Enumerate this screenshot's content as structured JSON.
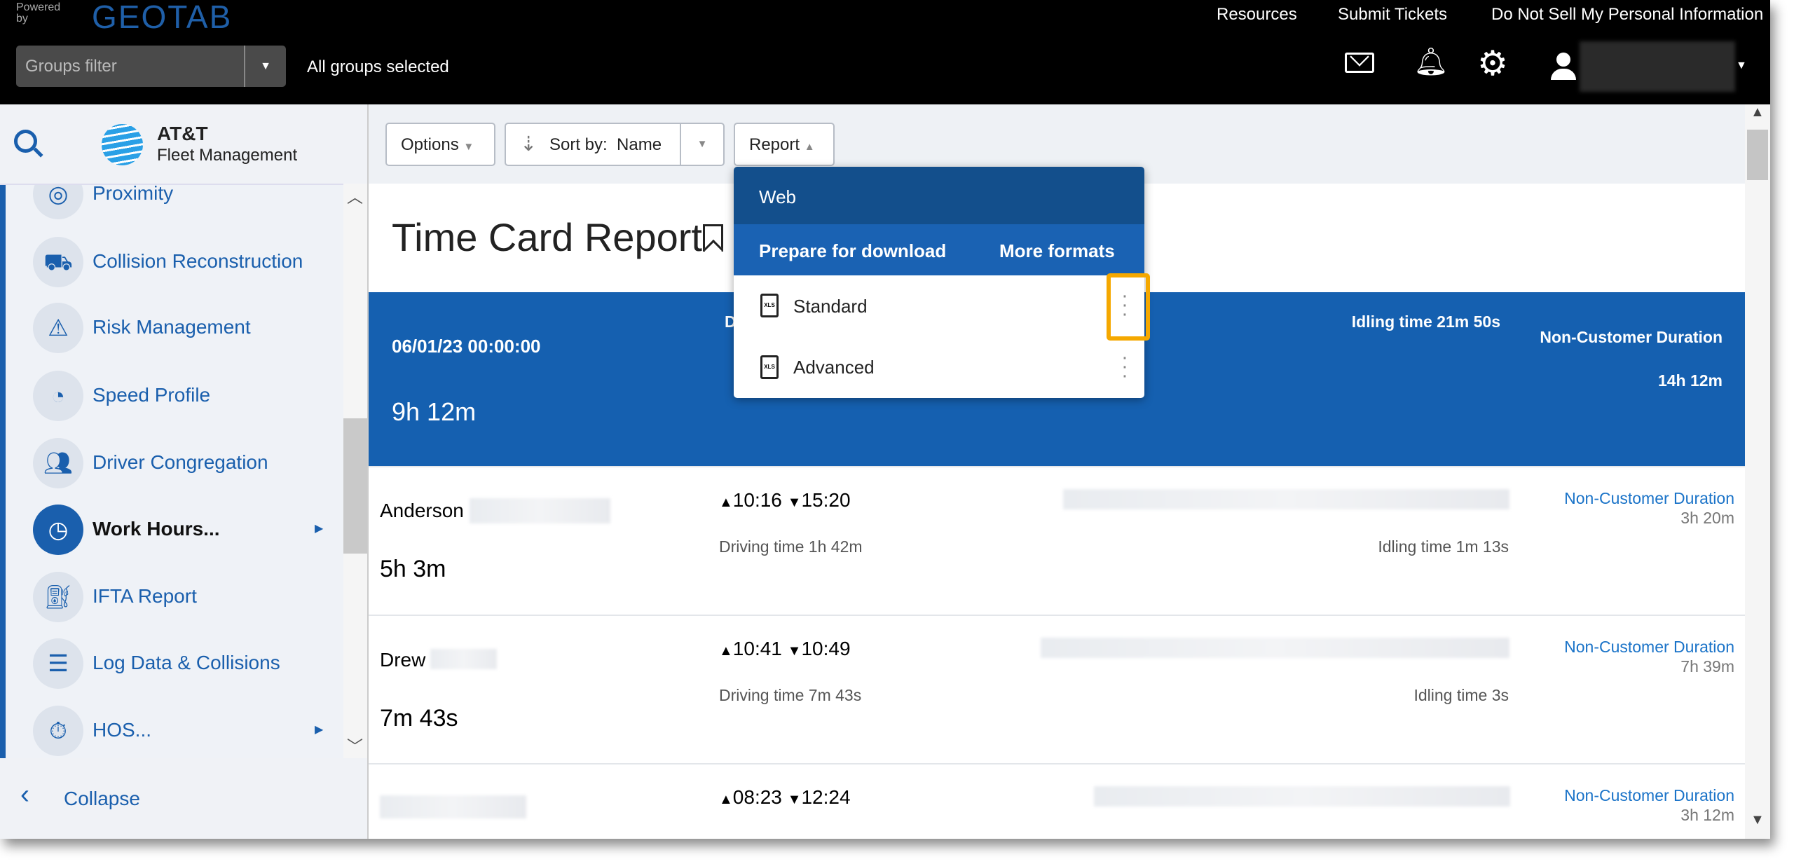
{
  "header": {
    "powered_by": "Powered by",
    "brand": "GEOTAB",
    "links": [
      "Resources",
      "Submit Tickets",
      "Do Not Sell My Personal Information"
    ],
    "groups_filter_placeholder": "Groups filter",
    "groups_status": "All groups selected"
  },
  "sidebar": {
    "logo_line1": "AT&T",
    "logo_line2": "Fleet Management",
    "items": [
      {
        "label": "Proximity",
        "icon": "proximity-icon"
      },
      {
        "label": "Collision Reconstruction",
        "icon": "collision-icon"
      },
      {
        "label": "Risk Management",
        "icon": "risk-icon"
      },
      {
        "label": "Speed Profile",
        "icon": "speedometer-icon"
      },
      {
        "label": "Driver Congregation",
        "icon": "people-pin-icon"
      },
      {
        "label": "Work Hours...",
        "icon": "clock-icon",
        "active": true,
        "submenu": true
      },
      {
        "label": "IFTA Report",
        "icon": "fuel-can-icon"
      },
      {
        "label": "Log Data & Collisions",
        "icon": "log-warning-icon"
      },
      {
        "label": "HOS...",
        "icon": "stopwatch-icon",
        "submenu": true
      }
    ],
    "collapse": "Collapse"
  },
  "toolbar": {
    "options": "Options",
    "sort_by": "Sort by:",
    "sort_value": "Name",
    "report": "Report"
  },
  "page_title": "Time Card Report",
  "summary": {
    "date": "06/01/23 00:00:00",
    "total": "9h 12m",
    "driving_partial": "D",
    "idling": "Idling time 21m 50s",
    "ncd_label": "Non-Customer Duration",
    "ncd_value": "14h 12m"
  },
  "rows": [
    {
      "name": "Anderson",
      "duration": "5h 3m",
      "start": "10:16",
      "end": "15:20",
      "driving": "Driving time 1h 42m",
      "idling": "Idling time 1m 13s",
      "ncd_label": "Non-Customer Duration",
      "ncd_value": "3h 20m"
    },
    {
      "name": "Drew",
      "duration": "7m 43s",
      "start": "10:41",
      "end": "10:49",
      "driving": "Driving time 7m 43s",
      "idling": "Idling time 3s",
      "ncd_label": "Non-Customer Duration",
      "ncd_value": "7h 39m"
    },
    {
      "name": "",
      "duration": "",
      "start": "08:23",
      "end": "12:24",
      "driving": "",
      "idling": "",
      "ncd_label": "Non-Customer Duration",
      "ncd_value": "3h 12m"
    }
  ],
  "report_menu": {
    "web": "Web",
    "prepare": "Prepare for download",
    "more_formats": "More formats",
    "items": [
      "Standard",
      "Advanced"
    ],
    "file_badge": "XLS"
  },
  "colors": {
    "brand_blue": "#1560b0",
    "menu_dark": "#134f8c",
    "highlight": "#f5a800",
    "link": "#1a73c8"
  }
}
